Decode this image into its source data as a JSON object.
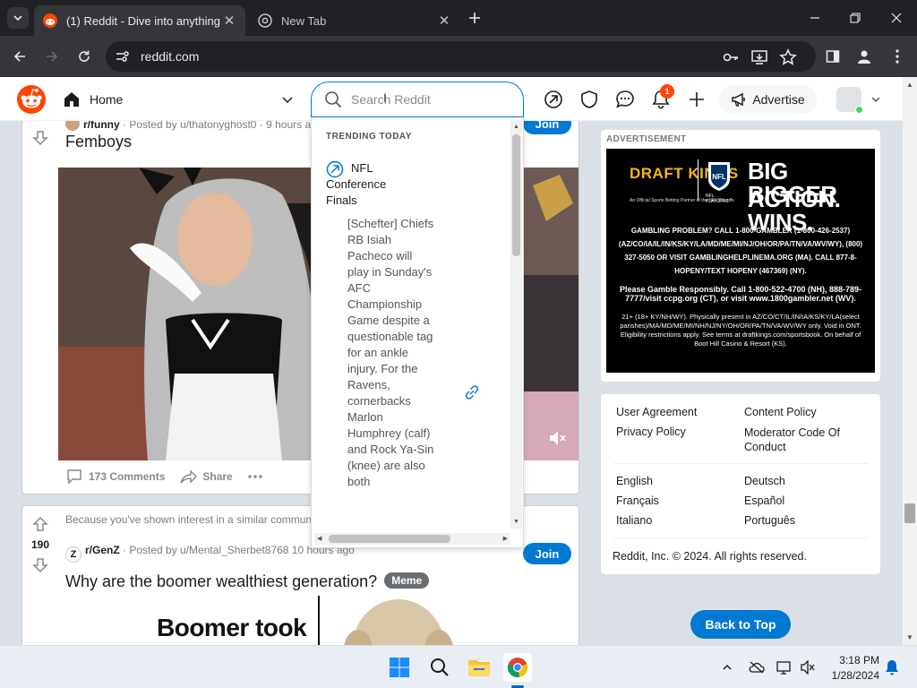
{
  "browser": {
    "tabs": [
      {
        "label": "(1) Reddit - Dive into anything"
      },
      {
        "label": "New Tab"
      }
    ],
    "url": "reddit.com"
  },
  "header": {
    "home_label": "Home",
    "notification_count": "1",
    "advertise_label": "Advertise"
  },
  "search": {
    "placeholder": "Search Reddit",
    "trending_label": "TRENDING TODAY",
    "trend_title": "NFL Conference Finals",
    "trend_description": "[Schefter] Chiefs RB Isiah Pacheco will play in Sunday's AFC Championship Game despite a questionable tag for an ankle injury. For the Ravens, cornerbacks Marlon Humphrey (calf) and Rock Ya-Sin (knee) are also both"
  },
  "posts": [
    {
      "subreddit": "r/funny",
      "posted_by": "· Posted by u/thatonyghost0 · 9 hours ago",
      "title": "Femboys",
      "comments": "173 Comments",
      "share": "Share",
      "join": "Join"
    },
    {
      "recommendation": "Because you've shown interest in a similar community",
      "votes": "190",
      "subreddit": "r/GenZ",
      "posted_by": "· Posted by u/Mental_Sherbet8768 10 hours ago",
      "title": "Why are the boomer wealthiest generation?",
      "flair": "Meme",
      "join": "Join",
      "image_text": "Boomer took"
    }
  ],
  "sidebar": {
    "ad_label": "ADVERTISEMENT",
    "ad": {
      "brand": "DRAFT KINGS",
      "brand_sub": "An Official Sports Betting Partner of the NFL Playoffs",
      "nfl": "NFL PLAYOFFS",
      "headline1": "BIG ACTION.",
      "headline2": "BIGGER WINS.",
      "fine1": "GAMBLING PROBLEM? CALL 1-800-GAMBLER (1-800-426-2537) (AZ/CO/IA/IL/IN/KS/KY/LA/MD/ME/MI/NJ/OH/OR/PA/TN/VA/WV/WY), (800) 327-5050 OR VISIT GAMBLINGHELPLINEMA.ORG (MA). CALL 877-8-HOPENY/TEXT HOPENY (467369) (NY).",
      "fine2": "Please Gamble Responsibly. Call 1-800-522-4700 (NH), 888-789-7777/visit ccpg.org (CT), or visit www.1800gambler.net (WV).",
      "fine3": "21+ (18+ KY/NH/WY). Physically present in AZ/CO/CT/IL/IN/IA/KS/KY/LA(select parishes)/MA/MD/ME/MI/NH/NJ/NY/OH/OR/PA/TN/VA/WV/WY only. Void in ONT. Eligibility restrictions apply. See terms at draftkings.com/sportsbook. On behalf of Boot Hill Casino & Resort (KS)."
    },
    "footer": {
      "user_agreement": "User Agreement",
      "content_policy": "Content Policy",
      "privacy_policy": "Privacy Policy",
      "moderator_code": "Moderator Code Of Conduct",
      "lang_en": "English",
      "lang_de": "Deutsch",
      "lang_fr": "Français",
      "lang_es": "Español",
      "lang_it": "Italiano",
      "lang_pt": "Português",
      "copyright": "Reddit, Inc. © 2024. All rights reserved."
    },
    "back_to_top": "Back to Top"
  },
  "taskbar": {
    "time": "3:18 PM",
    "date": "1/28/2024"
  },
  "colors": {
    "reddit_orange": "#ff4500",
    "reddit_blue": "#0079d3",
    "chrome_dark": "#202124"
  }
}
